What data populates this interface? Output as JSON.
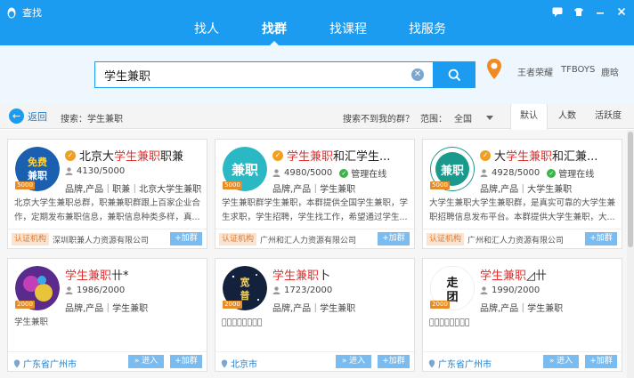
{
  "window": {
    "title": "查找",
    "controls": [
      "chat-icon",
      "skin-icon",
      "minimize-icon",
      "close-icon"
    ]
  },
  "nav": {
    "tabs": [
      {
        "label": "找人",
        "active": false
      },
      {
        "label": "找群",
        "active": true
      },
      {
        "label": "找课程",
        "active": false
      },
      {
        "label": "找服务",
        "active": false
      }
    ]
  },
  "search": {
    "value": "学生兼职",
    "hot_words": [
      "王者荣耀",
      "TFBOYS",
      "鹿晗"
    ]
  },
  "filter": {
    "back_label": "返回",
    "breadcrumb": "搜索：学生兼职",
    "not_found": "搜索不到我的群？",
    "range_label": "范围：",
    "range_value": "全国",
    "sort_options": [
      "默认",
      "人数",
      "活跃度"
    ],
    "sort_active": "默认"
  },
  "colors": {
    "brand": "#1c9cf0",
    "highlight": "#e0302e",
    "cert": "#e07a2d"
  },
  "cards": [
    {
      "name_prefix": "北京大",
      "name_highlight": "学生兼职",
      "name_suffix": "职兼",
      "certified": true,
      "members": "4130/5000",
      "level": "5000",
      "managed": "",
      "tags": "品牌,产品｜职兼｜北京大学生兼职",
      "desc": "北京大学生兼职总群，职兼兼职群跟上百家企业合作，定期发布兼职信息，兼职信息种类多样，真...",
      "cert_label": "认证机构",
      "org": "深圳职兼人力资源有限公司",
      "location": "",
      "enter": "",
      "join": "+加群"
    },
    {
      "name_prefix": "",
      "name_highlight": "学生兼职",
      "name_suffix": "和汇学生...",
      "certified": true,
      "members": "4980/5000",
      "level": "5000",
      "managed": "管理在线",
      "tags": "品牌,产品｜学生兼职",
      "desc": "学生兼职群学生兼职，本群提供全国学生兼职，学生求职，学生招聘，学生找工作，希望通过学生...",
      "cert_label": "认证机构",
      "org": "广州和汇人力资源有限公司",
      "location": "",
      "enter": "",
      "join": "+加群"
    },
    {
      "name_prefix": "大",
      "name_highlight": "学生兼职",
      "name_suffix": "和汇兼...",
      "certified": true,
      "members": "4928/5000",
      "level": "5000",
      "managed": "管理在线",
      "tags": "品牌,产品｜大学生兼职",
      "desc": "大学生兼职大学生兼职群，是真实可靠的大学生兼职招聘信息发布平台。本群提供大学生兼职，大...",
      "cert_label": "认证机构",
      "org": "广州和汇人力资源有限公司",
      "location": "",
      "enter": "",
      "join": "+加群"
    },
    {
      "name_prefix": "",
      "name_highlight": "学生兼职",
      "name_suffix": "卄*",
      "certified": false,
      "members": "1986/2000",
      "level": "2000",
      "managed": "",
      "tags": "品牌,产品｜学生兼职",
      "desc": "学生兼职",
      "cert_label": "",
      "org": "",
      "location": "广东省广州市",
      "enter": "» 进入",
      "join": "+加群"
    },
    {
      "name_prefix": "",
      "name_highlight": "学生兼职",
      "name_suffix": "卜",
      "certified": false,
      "members": "1723/2000",
      "level": "2000",
      "managed": "",
      "tags": "品牌,产品｜学生兼职",
      "desc": "学᷊生᷊兼᷊职᷊",
      "cert_label": "",
      "org": "",
      "location": "北京市",
      "enter": "» 进入",
      "join": "+加群"
    },
    {
      "name_prefix": "",
      "name_highlight": "学生兼职",
      "name_suffix": "◿卄",
      "certified": false,
      "members": "1990/2000",
      "level": "2000",
      "managed": "",
      "tags": "品牌,产品｜学生兼职",
      "desc": "学᷊生᷊兼᷊职᷊",
      "cert_label": "",
      "org": "",
      "location": "广东省广州市",
      "enter": "» 进入",
      "join": "+加群"
    }
  ]
}
